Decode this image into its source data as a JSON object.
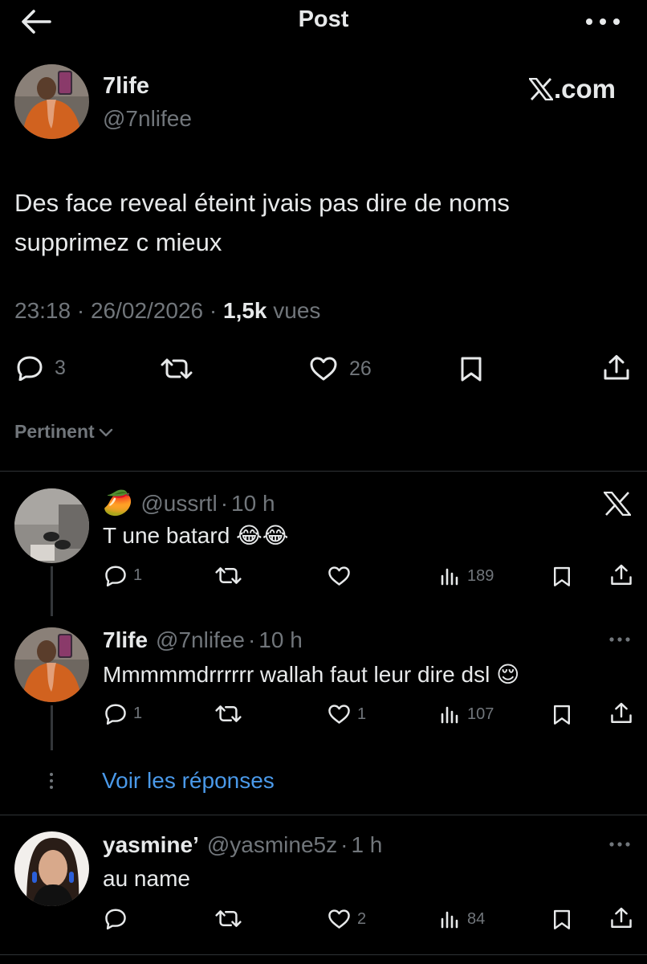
{
  "header": {
    "title": "Post",
    "back_icon": "arrow-left-icon",
    "more_icon": "more-horizontal-icon"
  },
  "post": {
    "author_name": "7life",
    "author_handle": "@7nlifee",
    "watermark": "X.com",
    "text": "Des face reveal éteint jvais pas dire de noms supprimez c mieux",
    "time": "23:18",
    "date": "26/02/2026",
    "views_count": "1,5k",
    "views_label": "vues",
    "stats": {
      "replies": "3",
      "reposts": "",
      "likes": "26"
    }
  },
  "sort": {
    "label": "Pertinent"
  },
  "replies": [
    {
      "emoji": "🥭",
      "name": "",
      "handle": "@ussrtl",
      "time": "10 h",
      "text": "T une batard 😂😂",
      "stats": {
        "replies": "1",
        "reposts": "",
        "likes": "",
        "views": "189"
      }
    },
    {
      "name": "7life",
      "handle": "@7nlifee",
      "time": "10 h",
      "text": "Mmmmmdrrrrrr wallah faut leur dire dsl 😌",
      "stats": {
        "replies": "1",
        "reposts": "",
        "likes": "1",
        "views": "107"
      }
    },
    {
      "name": "yasmine’",
      "handle": "@yasmine5z",
      "time": "1 h",
      "text": "au name",
      "stats": {
        "replies": "",
        "reposts": "",
        "likes": "2",
        "views": "84"
      }
    }
  ],
  "show_replies": {
    "label": "Voir les réponses"
  },
  "separator": "·",
  "colors": {
    "background": "#000000",
    "text": "#e7e9ea",
    "muted": "#71767b",
    "link": "#4a99e9",
    "divider": "#2f3336"
  }
}
